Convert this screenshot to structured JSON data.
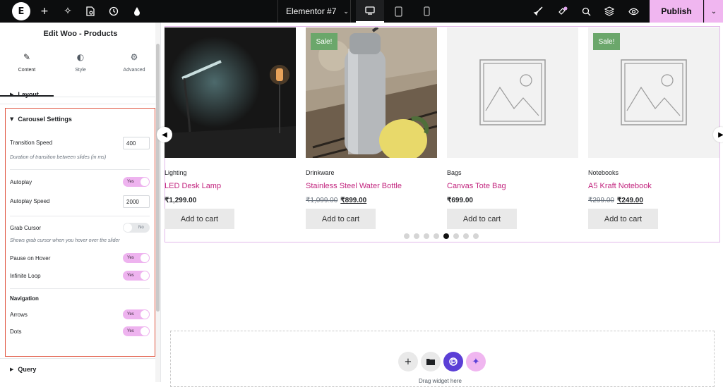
{
  "topbar": {
    "doc_title": "Elementor #7",
    "publish_label": "Publish",
    "colors": {
      "bar": "#0c0d0e",
      "publish": "#f0b6f0"
    },
    "icons": [
      "elementor-logo-icon",
      "add-icon",
      "ai-sparkle-icon",
      "page-settings-icon",
      "history-icon",
      "theme-style-icon",
      "desktop-icon",
      "tablet-icon",
      "mobile-icon",
      "rocket-icon",
      "notifications-icon",
      "search-icon",
      "structure-icon",
      "preview-icon",
      "chevron-down-icon"
    ]
  },
  "panel": {
    "title": "Edit Woo - Products",
    "tabs": [
      {
        "label": "Content",
        "icon": "pencil-icon"
      },
      {
        "label": "Style",
        "icon": "half-circle-icon"
      },
      {
        "label": "Advanced",
        "icon": "gear-icon"
      }
    ],
    "sections": {
      "layout": "Layout",
      "carousel": "Carousel Settings",
      "query": "Query"
    },
    "carousel": {
      "transition_speed_label": "Transition Speed",
      "transition_speed_value": "400",
      "transition_note": "Duration of transition between slides (in ms)",
      "autoplay_label": "Autoplay",
      "autoplay_value": "Yes",
      "autoplay_speed_label": "Autoplay Speed",
      "autoplay_speed_value": "2000",
      "grab_cursor_label": "Grab Cursor",
      "grab_cursor_value": "No",
      "grab_note": "Shows grab cursor when you hover over the slider",
      "pause_label": "Pause on Hover",
      "pause_value": "Yes",
      "loop_label": "Infinite Loop",
      "loop_value": "Yes",
      "navigation_heading": "Navigation",
      "arrows_label": "Arrows",
      "arrows_value": "Yes",
      "dots_label": "Dots",
      "dots_value": "Yes"
    }
  },
  "products": [
    {
      "category": "Lighting",
      "name": "LED Desk Lamp",
      "price": "₹1,299.00",
      "old_price": "",
      "sale": "",
      "add_label": "Add to cart"
    },
    {
      "category": "Drinkware",
      "name": "Stainless Steel Water Bottle",
      "price": "₹899.00",
      "old_price": "₹1,099.00",
      "sale": "Sale!",
      "add_label": "Add to cart"
    },
    {
      "category": "Bags",
      "name": "Canvas Tote Bag",
      "price": "₹699.00",
      "old_price": "",
      "sale": "",
      "add_label": "Add to cart"
    },
    {
      "category": "Notebooks",
      "name": "A5 Kraft Notebook",
      "price": "₹249.00",
      "old_price": "₹299.00",
      "sale": "Sale!",
      "add_label": "Add to cart"
    }
  ],
  "carousel_state": {
    "dot_count": 8,
    "active_dot": 5
  },
  "drop_zone": {
    "text": "Drag widget here"
  }
}
